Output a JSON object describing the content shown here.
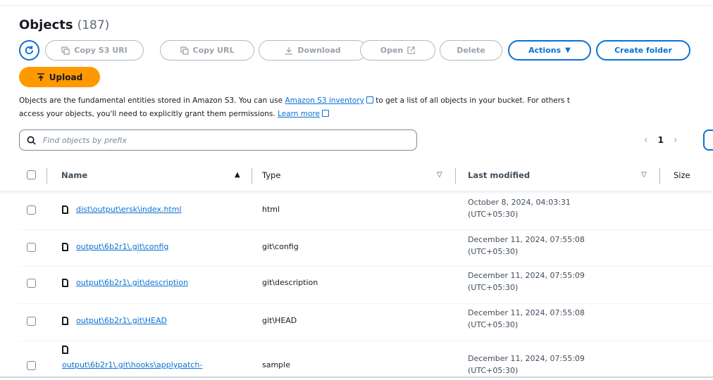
{
  "header": {
    "title": "Objects",
    "count": "(187)"
  },
  "toolbar": {
    "copy_s3_uri": "Copy S3 URI",
    "copy_url": "Copy URL",
    "download": "Download",
    "open": "Open",
    "delete": "Delete",
    "actions": "Actions",
    "create_folder": "Create folder",
    "upload": "Upload"
  },
  "description": {
    "text1": "Objects are the fundamental entities stored in Amazon S3. You can use ",
    "link1": "Amazon S3 inventory",
    "text2": " to get a list of all objects in your bucket. For others t",
    "text3": "access your objects, you'll need to explicitly grant them permissions. ",
    "link2": "Learn more"
  },
  "search": {
    "placeholder": "Find objects by prefix"
  },
  "pagination": {
    "current_page": "1"
  },
  "table": {
    "columns": {
      "name": "Name",
      "type": "Type",
      "last_modified": "Last modified",
      "size": "Size"
    },
    "rows": [
      {
        "name": "dist\\output\\ersk\\index.html",
        "type": "html",
        "modified_line1": "October 8, 2024, 04:03:31",
        "modified_line2": "(UTC+05:30)"
      },
      {
        "name": "output\\6b2r1\\.git\\config",
        "type": "git\\config",
        "modified_line1": "December 11, 2024, 07:55:08",
        "modified_line2": "(UTC+05:30)"
      },
      {
        "name": "output\\6b2r1\\.git\\description",
        "type": "git\\description",
        "modified_line1": "December 11, 2024, 07:55:09",
        "modified_line2": "(UTC+05:30)"
      },
      {
        "name": "output\\6b2r1\\.git\\HEAD",
        "type": "git\\HEAD",
        "modified_line1": "December 11, 2024, 07:55:08",
        "modified_line2": "(UTC+05:30)"
      },
      {
        "name": "output\\6b2r1\\.git\\hooks\\applypatch-",
        "type": "sample",
        "modified_line1": "December 11, 2024, 07:55:09",
        "modified_line2": "(UTC+05:30)"
      }
    ]
  },
  "colors": {
    "accent": "#0972d3",
    "upload_bg": "#ff9900",
    "text": "#16191f",
    "disabled": "#9ba2ab"
  },
  "icons": [
    "refresh-icon",
    "copy-icon",
    "download-icon",
    "external-link-icon",
    "upload-icon",
    "caret-down-icon",
    "search-icon",
    "chevron-left-icon",
    "chevron-right-icon",
    "sort-up-icon",
    "sort-down-icon",
    "file-icon"
  ]
}
